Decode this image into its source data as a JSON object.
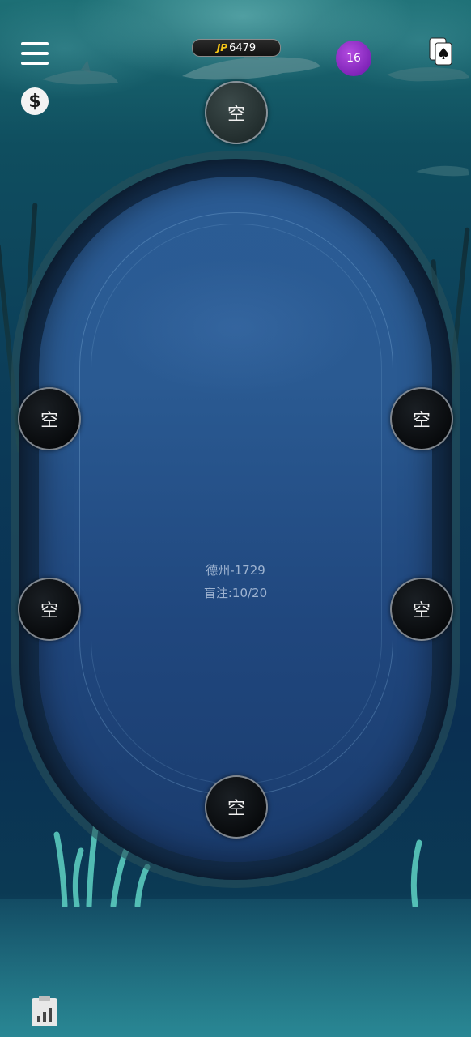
{
  "jackpot": {
    "tag": "JP",
    "value": "6479"
  },
  "player": {
    "level": "16"
  },
  "table": {
    "name": "德州-1729",
    "blinds": "盲注:10/20"
  },
  "seats": [
    {
      "label": "空"
    },
    {
      "label": "空"
    },
    {
      "label": "空"
    },
    {
      "label": "空"
    },
    {
      "label": "空"
    },
    {
      "label": "空"
    }
  ],
  "icons": {
    "menu": "menu-icon",
    "dollar": "dollar-icon",
    "level": "level-badge",
    "cards": "playing-card-icon",
    "stats": "stats-clipboard-icon"
  },
  "colors": {
    "accent_gold": "#f5c518",
    "level_purple": "#8a2bd0",
    "felt_blue": "#2a5a92"
  }
}
